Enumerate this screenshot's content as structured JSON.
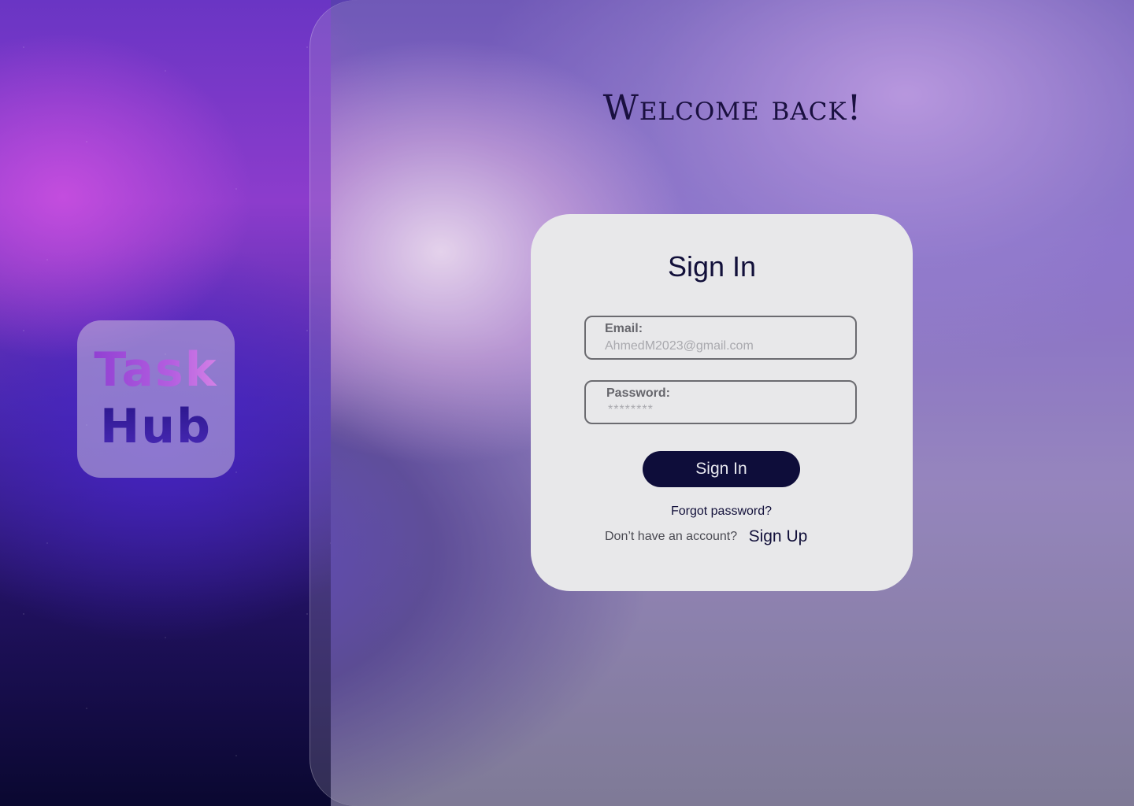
{
  "brand": {
    "logo_line1": "Task",
    "logo_line2": "Hub"
  },
  "header": {
    "welcome": "Welcome back!"
  },
  "signin_card": {
    "title": "Sign In",
    "email": {
      "label": "Email:",
      "placeholder": "AhmedM2023@gmail.com"
    },
    "password": {
      "label": "Password:",
      "placeholder": "********"
    },
    "submit_label": "Sign In",
    "forgot_label": "Forgot password?",
    "signup_prompt": "Don’t have an account?",
    "signup_label": "Sign Up"
  },
  "colors": {
    "primary_dark": "#0e0d3a",
    "card_bg": "#e8e8ea",
    "field_border": "#6b6b70",
    "logo_purple": "#a84ed8",
    "logo_indigo": "#3a1d9c"
  }
}
